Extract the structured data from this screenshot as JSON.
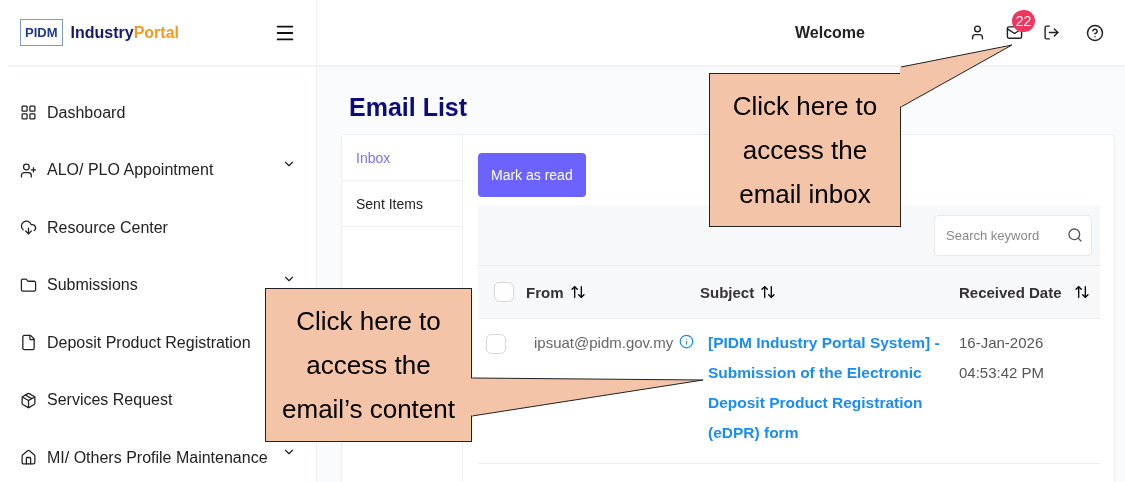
{
  "header": {
    "logo_mark": "PIDM",
    "brand": [
      "Industry",
      "Portal"
    ],
    "welcome": "Welcome",
    "mail_badge": "22"
  },
  "sidebar": {
    "items": [
      {
        "label": "Dashboard",
        "expandable": false
      },
      {
        "label": "ALO/ PLO Appointment",
        "expandable": true
      },
      {
        "label": "Resource Center",
        "expandable": false
      },
      {
        "label": "Submissions",
        "expandable": true
      },
      {
        "label": "Deposit Product Registration"
      },
      {
        "label": "Services Request"
      },
      {
        "label": "MI/ Others Profile Maintenance",
        "expandable": true
      }
    ]
  },
  "page_title": "Email List",
  "tabs": [
    {
      "label": "Inbox",
      "selected": true
    },
    {
      "label": "Sent Items",
      "selected": false
    }
  ],
  "mark_read_button": "Mark as read",
  "search": {
    "placeholder": "Search keyword"
  },
  "table": {
    "select_all_checked": false,
    "columns": [
      "From",
      "Subject",
      "Received Date"
    ],
    "rows": [
      {
        "checked": false,
        "from": "ipsuat@pidm.gov.my",
        "subject": "[PIDM Industry Portal System] - Submission of the Electronic Deposit Product Registration (eDPR) form",
        "received": [
          "16-Jan-2026",
          "04:53:42 PM"
        ]
      }
    ]
  },
  "callouts": [
    {
      "text": "Click here to access the email inbox"
    },
    {
      "text": "Click here to access the email’s content"
    }
  ]
}
